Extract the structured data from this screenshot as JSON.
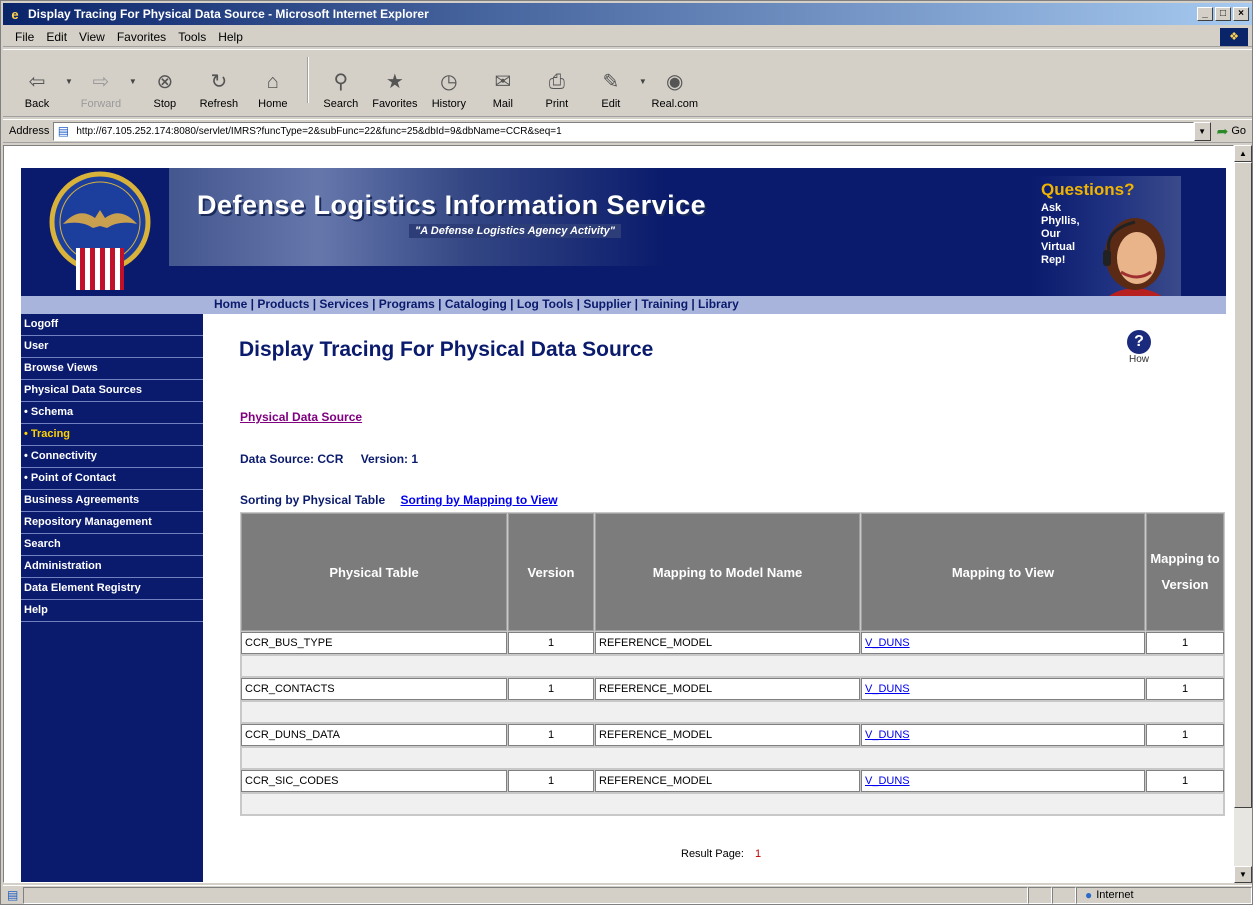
{
  "window": {
    "title": "Display Tracing For Physical Data Source - Microsoft Internet Explorer",
    "controls": [
      "_",
      "×"
    ]
  },
  "menu": [
    "File",
    "Edit",
    "View",
    "Favorites",
    "Tools",
    "Help"
  ],
  "toolbar": {
    "back": "Back",
    "forward": "Forward",
    "stop": "Stop",
    "refresh": "Refresh",
    "home": "Home",
    "search": "Search",
    "favorites": "Favorites",
    "history": "History",
    "mail": "Mail",
    "print": "Print",
    "edit": "Edit",
    "real": "Real.com"
  },
  "address": {
    "label": "Address",
    "url": "http://67.105.252.174:8080/servlet/IMRS?funcType=2&subFunc=22&func=25&dbId=9&dbName=CCR&seq=1",
    "go": "Go"
  },
  "banner": {
    "title": "Defense Logistics Information Service",
    "subtitle": "\"A Defense Logistics Agency Activity\"",
    "questions_title": "Questions?",
    "questions_text": "Ask Phyllis, Our Virtual Rep!",
    "nav": "Home | Products | Services | Programs | Cataloging | Log Tools | Supplier | Training | Library"
  },
  "sidebar": {
    "items": [
      {
        "label": "Logoff"
      },
      {
        "label": "User"
      },
      {
        "label": "Browse Views"
      },
      {
        "label": "Physical Data Sources"
      },
      {
        "label": "• Schema"
      },
      {
        "label": "• Tracing",
        "active": true
      },
      {
        "label": "• Connectivity"
      },
      {
        "label": "• Point of Contact"
      },
      {
        "label": "Business Agreements"
      },
      {
        "label": "Repository Management"
      },
      {
        "label": "Search"
      },
      {
        "label": "Administration"
      },
      {
        "label": "Data Element Registry"
      },
      {
        "label": "Help"
      }
    ]
  },
  "main": {
    "title": "Display Tracing For Physical Data Source",
    "help_label": "How",
    "pds_link": "Physical Data Source",
    "data_source": "Data Source: CCR",
    "version": "Version: 1",
    "sort_current": "Sorting by Physical Table",
    "sort_link": "Sorting by Mapping to View",
    "table": {
      "headers": [
        "Physical Table",
        "Version",
        "Mapping to Model Name",
        "Mapping to View",
        "Mapping to Version"
      ],
      "rows": [
        {
          "table": "CCR_BUS_TYPE",
          "version": "1",
          "model": "REFERENCE_MODEL",
          "view": "V_DUNS",
          "map_version": "1"
        },
        {
          "table": "CCR_CONTACTS",
          "version": "1",
          "model": "REFERENCE_MODEL",
          "view": "V_DUNS",
          "map_version": "1"
        },
        {
          "table": "CCR_DUNS_DATA",
          "version": "1",
          "model": "REFERENCE_MODEL",
          "view": "V_DUNS",
          "map_version": "1"
        },
        {
          "table": "CCR_SIC_CODES",
          "version": "1",
          "model": "REFERENCE_MODEL",
          "view": "V_DUNS",
          "map_version": "1"
        }
      ]
    },
    "result_label": "Result Page:",
    "result_page": "1"
  },
  "status": {
    "zone": "Internet"
  }
}
